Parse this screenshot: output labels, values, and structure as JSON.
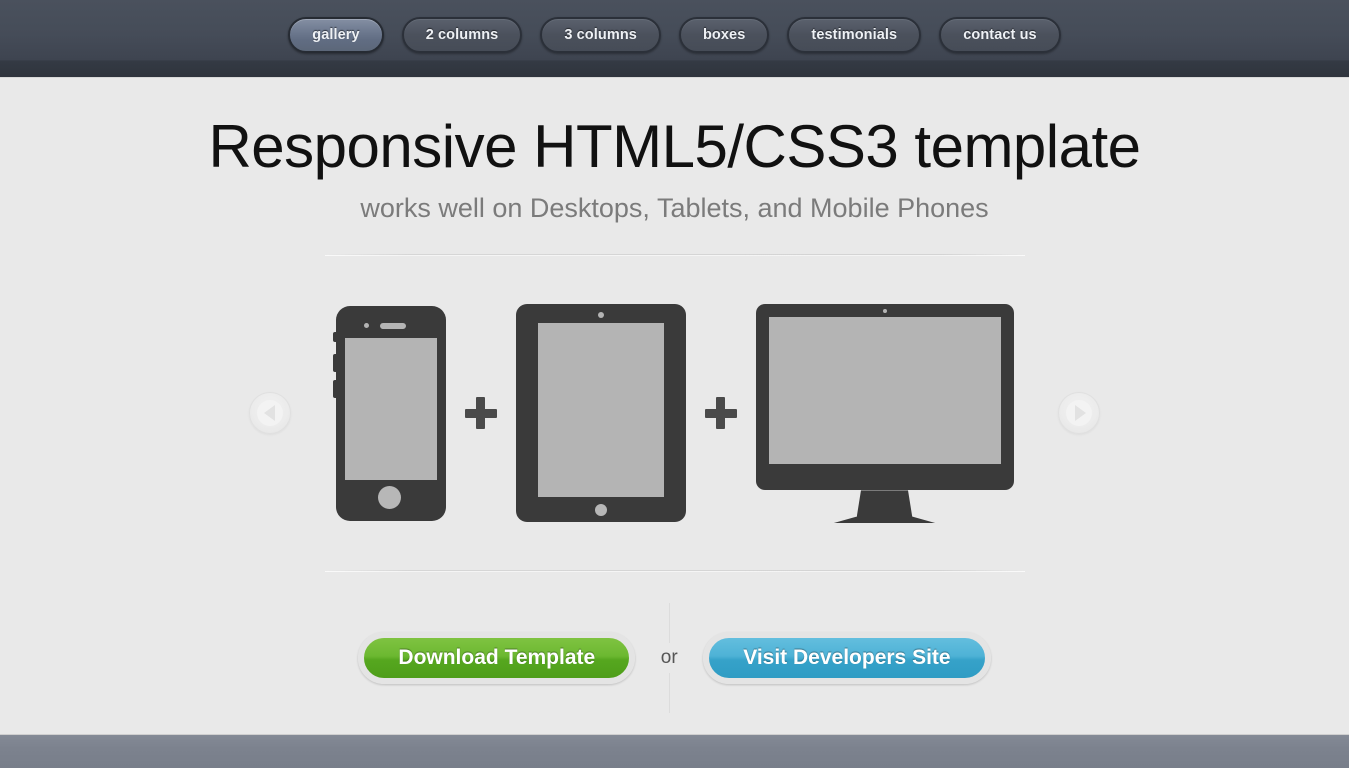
{
  "nav": {
    "items": [
      {
        "label": "gallery",
        "active": true
      },
      {
        "label": "2 columns",
        "active": false
      },
      {
        "label": "3 columns",
        "active": false
      },
      {
        "label": "boxes",
        "active": false
      },
      {
        "label": "testimonials",
        "active": false
      },
      {
        "label": "contact us",
        "active": false
      }
    ]
  },
  "hero": {
    "title": "Responsive HTML5/CSS3 template",
    "subtitle": "works well on Desktops, Tablets, and Mobile Phones"
  },
  "slider": {
    "prev_icon": "arrow-left-icon",
    "next_icon": "arrow-right-icon",
    "devices": [
      {
        "name": "mobile-phone",
        "icon": "phone-icon"
      },
      {
        "name": "tablet",
        "icon": "tablet-icon"
      },
      {
        "name": "desktop-monitor",
        "icon": "monitor-icon"
      }
    ],
    "separator": "+"
  },
  "cta": {
    "download_label": "Download Template",
    "or_label": "or",
    "visit_label": "Visit Developers Site"
  },
  "colors": {
    "navbar": "#454c58",
    "page_background": "#e9e9e9",
    "device_body": "#3a3a3a",
    "device_screen": "#b4b4b4",
    "green_button": "#6cb831",
    "blue_button": "#4eb2d6",
    "footer": "#7c828e",
    "title_text": "#111111",
    "subtitle_text": "#7b7b7b"
  }
}
